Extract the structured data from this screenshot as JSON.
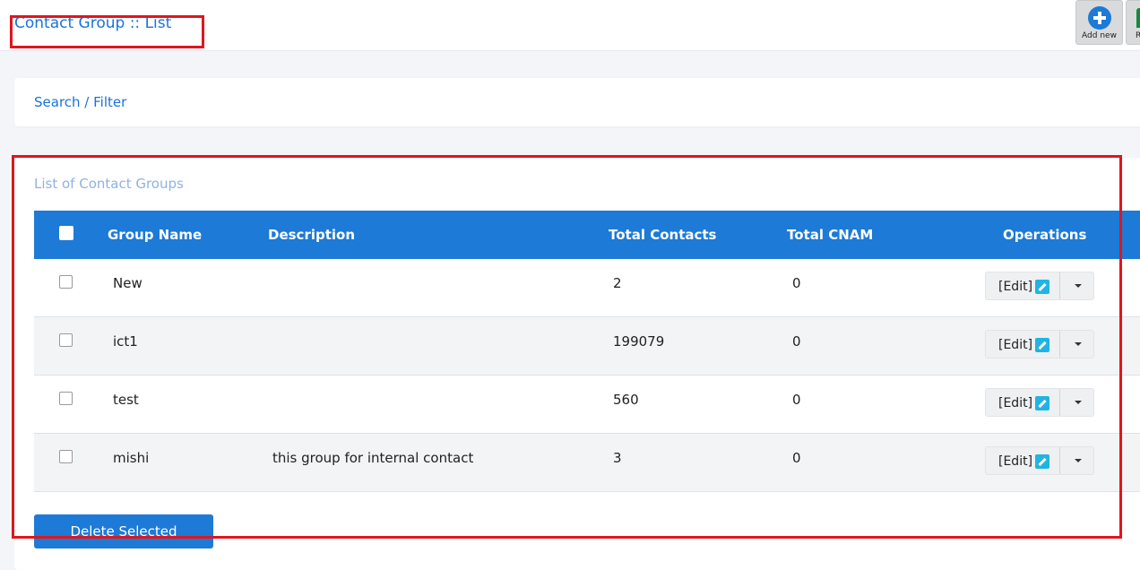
{
  "header": {
    "title": "Contact Group :: List",
    "add_new_label": "Add new",
    "second_button_label": "Re"
  },
  "filter": {
    "label": "Search / Filter"
  },
  "list": {
    "title": "List of Contact Groups",
    "columns": [
      "Group Name",
      "Description",
      "Total Contacts",
      "Total CNAM",
      "Operations"
    ],
    "rows": [
      {
        "name": "New",
        "description": "",
        "total_contacts": "2",
        "total_cnam": "0",
        "edit_label": "[Edit]"
      },
      {
        "name": "ict1",
        "description": "",
        "total_contacts": "199079",
        "total_cnam": "0",
        "edit_label": "[Edit]"
      },
      {
        "name": "test",
        "description": "",
        "total_contacts": "560",
        "total_cnam": "0",
        "edit_label": "[Edit]"
      },
      {
        "name": "mishi",
        "description": "this group for internal contact",
        "total_contacts": "3",
        "total_cnam": "0",
        "edit_label": "[Edit]"
      }
    ]
  },
  "actions": {
    "delete_selected": "Delete Selected"
  },
  "colors": {
    "accent": "#1d7ad6",
    "highlight": "#e0161c",
    "link": "#1a73d9"
  }
}
